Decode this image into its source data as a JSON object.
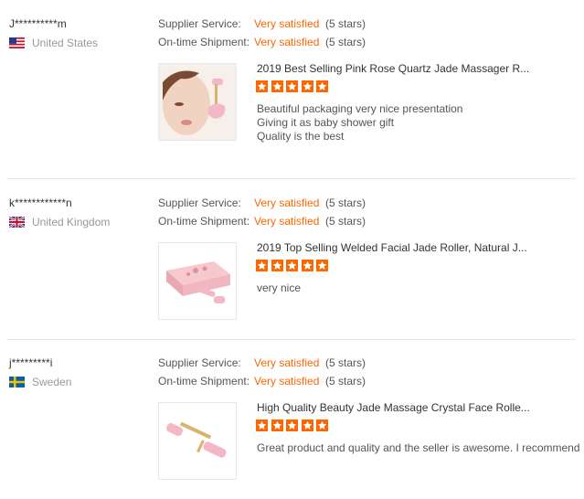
{
  "reviews": [
    {
      "username": "J**********m",
      "country": "United States",
      "flag_icon": "us-flag-icon",
      "supplier_service_label": "Supplier Service:",
      "supplier_service_value": "Very satisfied",
      "supplier_service_stars": "(5 stars)",
      "shipment_label": "On-time Shipment:",
      "shipment_value": "Very satisfied",
      "shipment_stars": "(5 stars)",
      "product_title": "2019 Best Selling Pink Rose Quartz Jade Massager R...",
      "rating": 5,
      "comment_lines": [
        "Beautiful packaging very nice presentation",
        "Giving it as baby shower gift",
        "Quality is the best"
      ]
    },
    {
      "username": "k************n",
      "country": "United Kingdom",
      "flag_icon": "uk-flag-icon",
      "supplier_service_label": "Supplier Service:",
      "supplier_service_value": "Very satisfied",
      "supplier_service_stars": "(5 stars)",
      "shipment_label": "On-time Shipment:",
      "shipment_value": "Very satisfied",
      "shipment_stars": "(5 stars)",
      "product_title": "2019 Top Selling Welded Facial Jade Roller, Natural J...",
      "rating": 5,
      "comment_lines": [
        "very nice"
      ]
    },
    {
      "username": "j*********i",
      "country": "Sweden",
      "flag_icon": "sweden-flag-icon",
      "supplier_service_label": "Supplier Service:",
      "supplier_service_value": "Very satisfied",
      "supplier_service_stars": "(5 stars)",
      "shipment_label": "On-time Shipment:",
      "shipment_value": "Very satisfied",
      "shipment_stars": "(5 stars)",
      "product_title": "High Quality Beauty Jade Massage Crystal Face Rolle...",
      "rating": 5,
      "comment_lines": [
        "Great product and quality and the seller is awesome. I recommend"
      ]
    }
  ],
  "colors": {
    "accent": "#ff6600",
    "star": "#ff6600",
    "muted": "#999999",
    "divider": "#e6e6e6"
  }
}
